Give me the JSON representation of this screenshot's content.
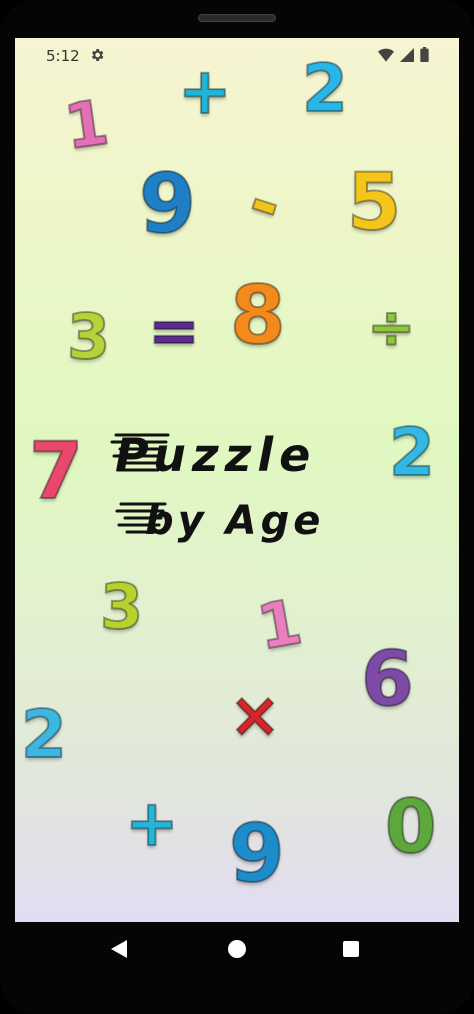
{
  "status_bar": {
    "time": "5:12",
    "icons": [
      "gear-icon",
      "wifi-icon",
      "signal-icon",
      "battery-icon"
    ]
  },
  "title": {
    "line1": "Puzzle",
    "line2": "by Age"
  },
  "decorations": [
    {
      "char": "+",
      "color": "#1fb6d8"
    },
    {
      "char": "2",
      "color": "#2ab5e6"
    },
    {
      "char": "1",
      "color": "#e36fb5"
    },
    {
      "char": "9",
      "color": "#1f7fc4"
    },
    {
      "char": "-",
      "color": "#f2c21d"
    },
    {
      "char": "5",
      "color": "#f4c51a"
    },
    {
      "char": "3",
      "color": "#b6d33a"
    },
    {
      "char": "=",
      "color": "#5b2b90"
    },
    {
      "char": "8",
      "color": "#f28a1c"
    },
    {
      "char": "÷",
      "color": "#8ec63f"
    },
    {
      "char": "7",
      "color": "#e9486a"
    },
    {
      "char": "2",
      "color": "#33b8e4"
    },
    {
      "char": "3",
      "color": "#b7d12e"
    },
    {
      "char": "1",
      "color": "#ea7fbf"
    },
    {
      "char": "6",
      "color": "#7d4aa8"
    },
    {
      "char": "2",
      "color": "#3db7e2"
    },
    {
      "char": "×",
      "color": "#d7262b"
    },
    {
      "char": "+",
      "color": "#27b5d7"
    },
    {
      "char": "9",
      "color": "#1e8bcb"
    },
    {
      "char": "0",
      "color": "#5da83c"
    }
  ]
}
